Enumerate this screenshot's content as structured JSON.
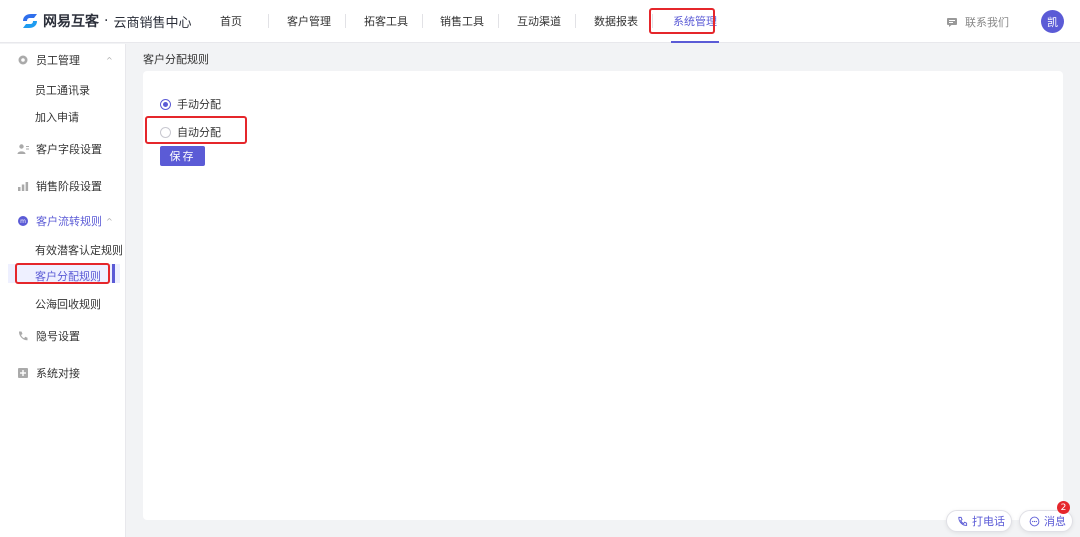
{
  "header": {
    "brand": "网易互客",
    "separator": "·",
    "subtitle": "云商销售中心",
    "nav": [
      "首页",
      "客户管理",
      "拓客工具",
      "销售工具",
      "互动渠道",
      "数据报表",
      "系统管理"
    ],
    "active_nav": "系统管理",
    "contact_label": "联系我们",
    "avatar_text": "凯"
  },
  "sidebar": {
    "groups": [
      {
        "label": "员工管理",
        "icon": "gear-icon",
        "expanded": true,
        "items": [
          "员工通讯录",
          "加入申请"
        ]
      },
      {
        "label": "客户字段设置",
        "icon": "user-fields-icon"
      },
      {
        "label": "销售阶段设置",
        "icon": "bar-chart-icon"
      },
      {
        "label": "客户流转规则",
        "icon": "flow-icon",
        "expanded": true,
        "items": [
          "有效潜客认定规则",
          "客户分配规则",
          "公海回收规则"
        ]
      },
      {
        "label": "隐号设置",
        "icon": "phone-icon"
      },
      {
        "label": "系统对接",
        "icon": "connect-icon"
      }
    ],
    "active_item": "客户分配规则"
  },
  "main": {
    "title": "客户分配规则",
    "options": [
      {
        "label": "手动分配",
        "checked": true
      },
      {
        "label": "自动分配",
        "checked": false
      }
    ],
    "save_label": "保存"
  },
  "floating": {
    "call_label": "打电话",
    "message_label": "消息",
    "message_count": "2"
  },
  "colors": {
    "accent": "#5b5bd6",
    "highlight": "#e5262b",
    "background": "#f2f3f5"
  }
}
